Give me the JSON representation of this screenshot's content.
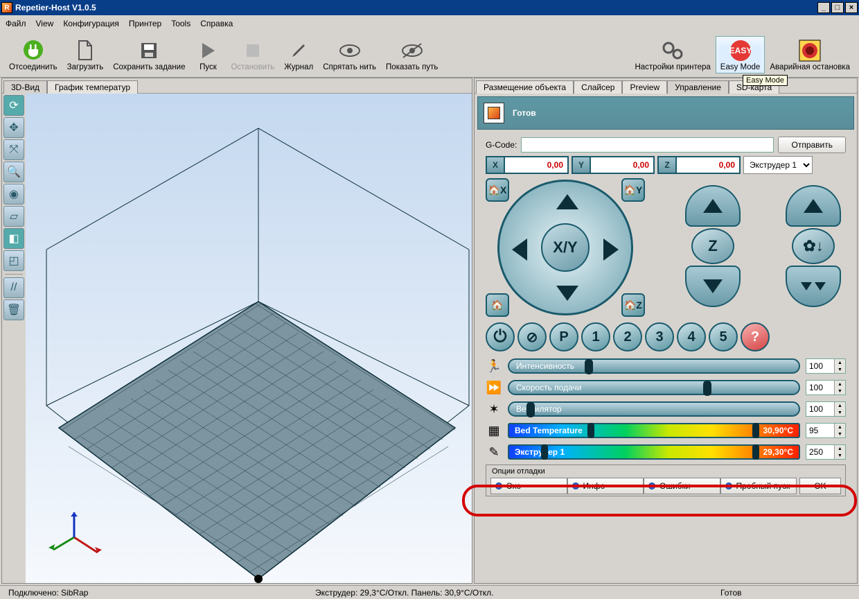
{
  "window": {
    "title": "Repetier-Host V1.0.5"
  },
  "menu": [
    "Файл",
    "View",
    "Конфигурация",
    "Принтер",
    "Tools",
    "Справка"
  ],
  "toolbar": {
    "disconnect": "Отсоединить",
    "load": "Загрузить",
    "save": "Сохранить задание",
    "run": "Пуск",
    "stop": "Остановить",
    "log": "Журнал",
    "hide": "Спрятать нить",
    "show_path": "Показать путь",
    "printer_settings": "Настройки принтера",
    "easy_mode": "Easy Mode",
    "estop": "Аварийная остановка",
    "tooltip": "Easy Mode"
  },
  "left_tabs": {
    "view3d": "3D-Вид",
    "tempgraph": "График температур"
  },
  "right_tabs": {
    "object": "Размещение объекта",
    "slicer": "Слайсер",
    "preview": "Preview",
    "control": "Управление",
    "sd": "SD-карта"
  },
  "status_header": "Готов",
  "gcode_label": "G-Code:",
  "send_btn": "Отправить",
  "coords": {
    "x": "0,00",
    "y": "0,00",
    "z": "0,00"
  },
  "extruder_sel": "Экструдер 1",
  "sliders": {
    "speed": {
      "label": "Интенсивность",
      "value": "100"
    },
    "feed": {
      "label": "Скорость подачи",
      "value": "100"
    },
    "fan": {
      "label": "Вентилятор",
      "value": "100"
    },
    "bed": {
      "label": "Bed Temperature",
      "reading": "30,90°C",
      "value": "95"
    },
    "ext": {
      "label": "Экструдер 1",
      "reading": "29,30°C",
      "value": "250"
    }
  },
  "debug": {
    "title": "Опции отладки",
    "echo": "Эхо",
    "info": "Инфо",
    "errors": "Ошибки",
    "dry": "Пробный пуск",
    "ok": "OK"
  },
  "statusbar": {
    "conn": "Подключено: SibRap",
    "temps": "Экструдер: 29,3°C/Откл. Панель: 30,9°C/Откл.",
    "ready": "Готов"
  }
}
